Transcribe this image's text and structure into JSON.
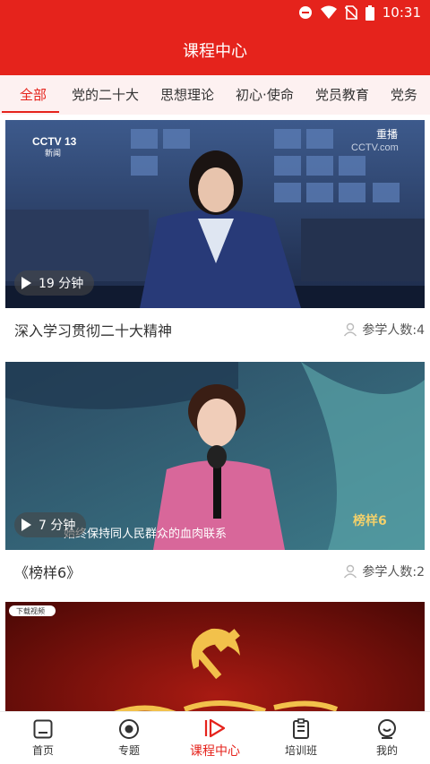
{
  "status_bar": {
    "time": "10:31",
    "icons": [
      "minus-circle-icon",
      "wifi-icon",
      "no-sim-icon",
      "battery-icon"
    ]
  },
  "header": {
    "title": "课程中心"
  },
  "tabs": [
    {
      "label": "全部",
      "active": true
    },
    {
      "label": "党的二十大"
    },
    {
      "label": "思想理论"
    },
    {
      "label": "初心·使命"
    },
    {
      "label": "党员教育"
    },
    {
      "label": "党务"
    }
  ],
  "courses": [
    {
      "title": "深入学习贯彻二十大精神",
      "duration": "19 分钟",
      "learners": "参学人数:4",
      "thumb_logo": "CCTV 13",
      "thumb_sub": "新闻",
      "thumb_badge": "重播",
      "thumb_watermark": "CCTV.com"
    },
    {
      "title": "《榜样6》",
      "duration": "7 分钟",
      "learners": "参学人数:2",
      "thumb_caption": "始终保持同人民群众的血肉联系",
      "thumb_badge": "榜样6"
    },
    {
      "thumb_tag": "下载视频"
    }
  ],
  "bottom_nav": [
    {
      "label": "首页",
      "icon": "home-icon"
    },
    {
      "label": "专题",
      "icon": "topic-icon"
    },
    {
      "label": "课程中心",
      "icon": "course-play-icon",
      "active": true
    },
    {
      "label": "培训班",
      "icon": "training-icon"
    },
    {
      "label": "我的",
      "icon": "profile-icon"
    }
  ],
  "colors": {
    "brand": "#e5231c",
    "tab_bg": "#fdf1f1"
  }
}
